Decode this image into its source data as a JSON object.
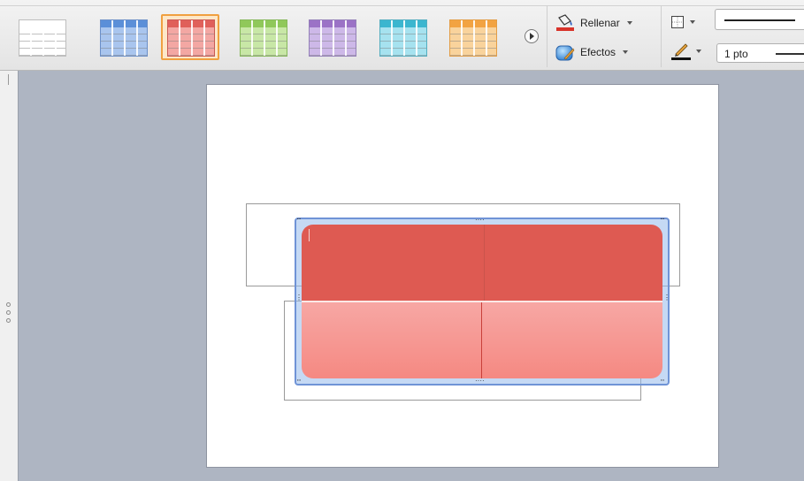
{
  "ribbon": {
    "table_styles": [
      {
        "name": "plain",
        "header": "#ffffff",
        "body": "#ffffff",
        "line": "#bdbdbd",
        "selected": false
      },
      {
        "name": "blue",
        "header": "#5b8fd8",
        "body": "#a9c5ee",
        "line": "#6b8fc8",
        "selected": false
      },
      {
        "name": "red",
        "header": "#e0605a",
        "body": "#f3a7a3",
        "line": "#c95a55",
        "selected": true
      },
      {
        "name": "green",
        "header": "#90c85a",
        "body": "#c8e7a6",
        "line": "#86b85a",
        "selected": false
      },
      {
        "name": "purple",
        "header": "#9b72c6",
        "body": "#cdb8e8",
        "line": "#9480b8",
        "selected": false
      },
      {
        "name": "teal",
        "header": "#3bb6cf",
        "body": "#a6e2ef",
        "line": "#53aec0",
        "selected": false
      },
      {
        "name": "orange",
        "header": "#f2a342",
        "body": "#f9d39c",
        "line": "#e39d45",
        "selected": false
      }
    ],
    "fill": {
      "label": "Rellenar"
    },
    "effects": {
      "label": "Efectos"
    },
    "line_weight": "1 pto"
  },
  "colors": {
    "header_red": "#de5a52",
    "body_red": "#f58982",
    "selection_blue": "#6f93d6"
  }
}
